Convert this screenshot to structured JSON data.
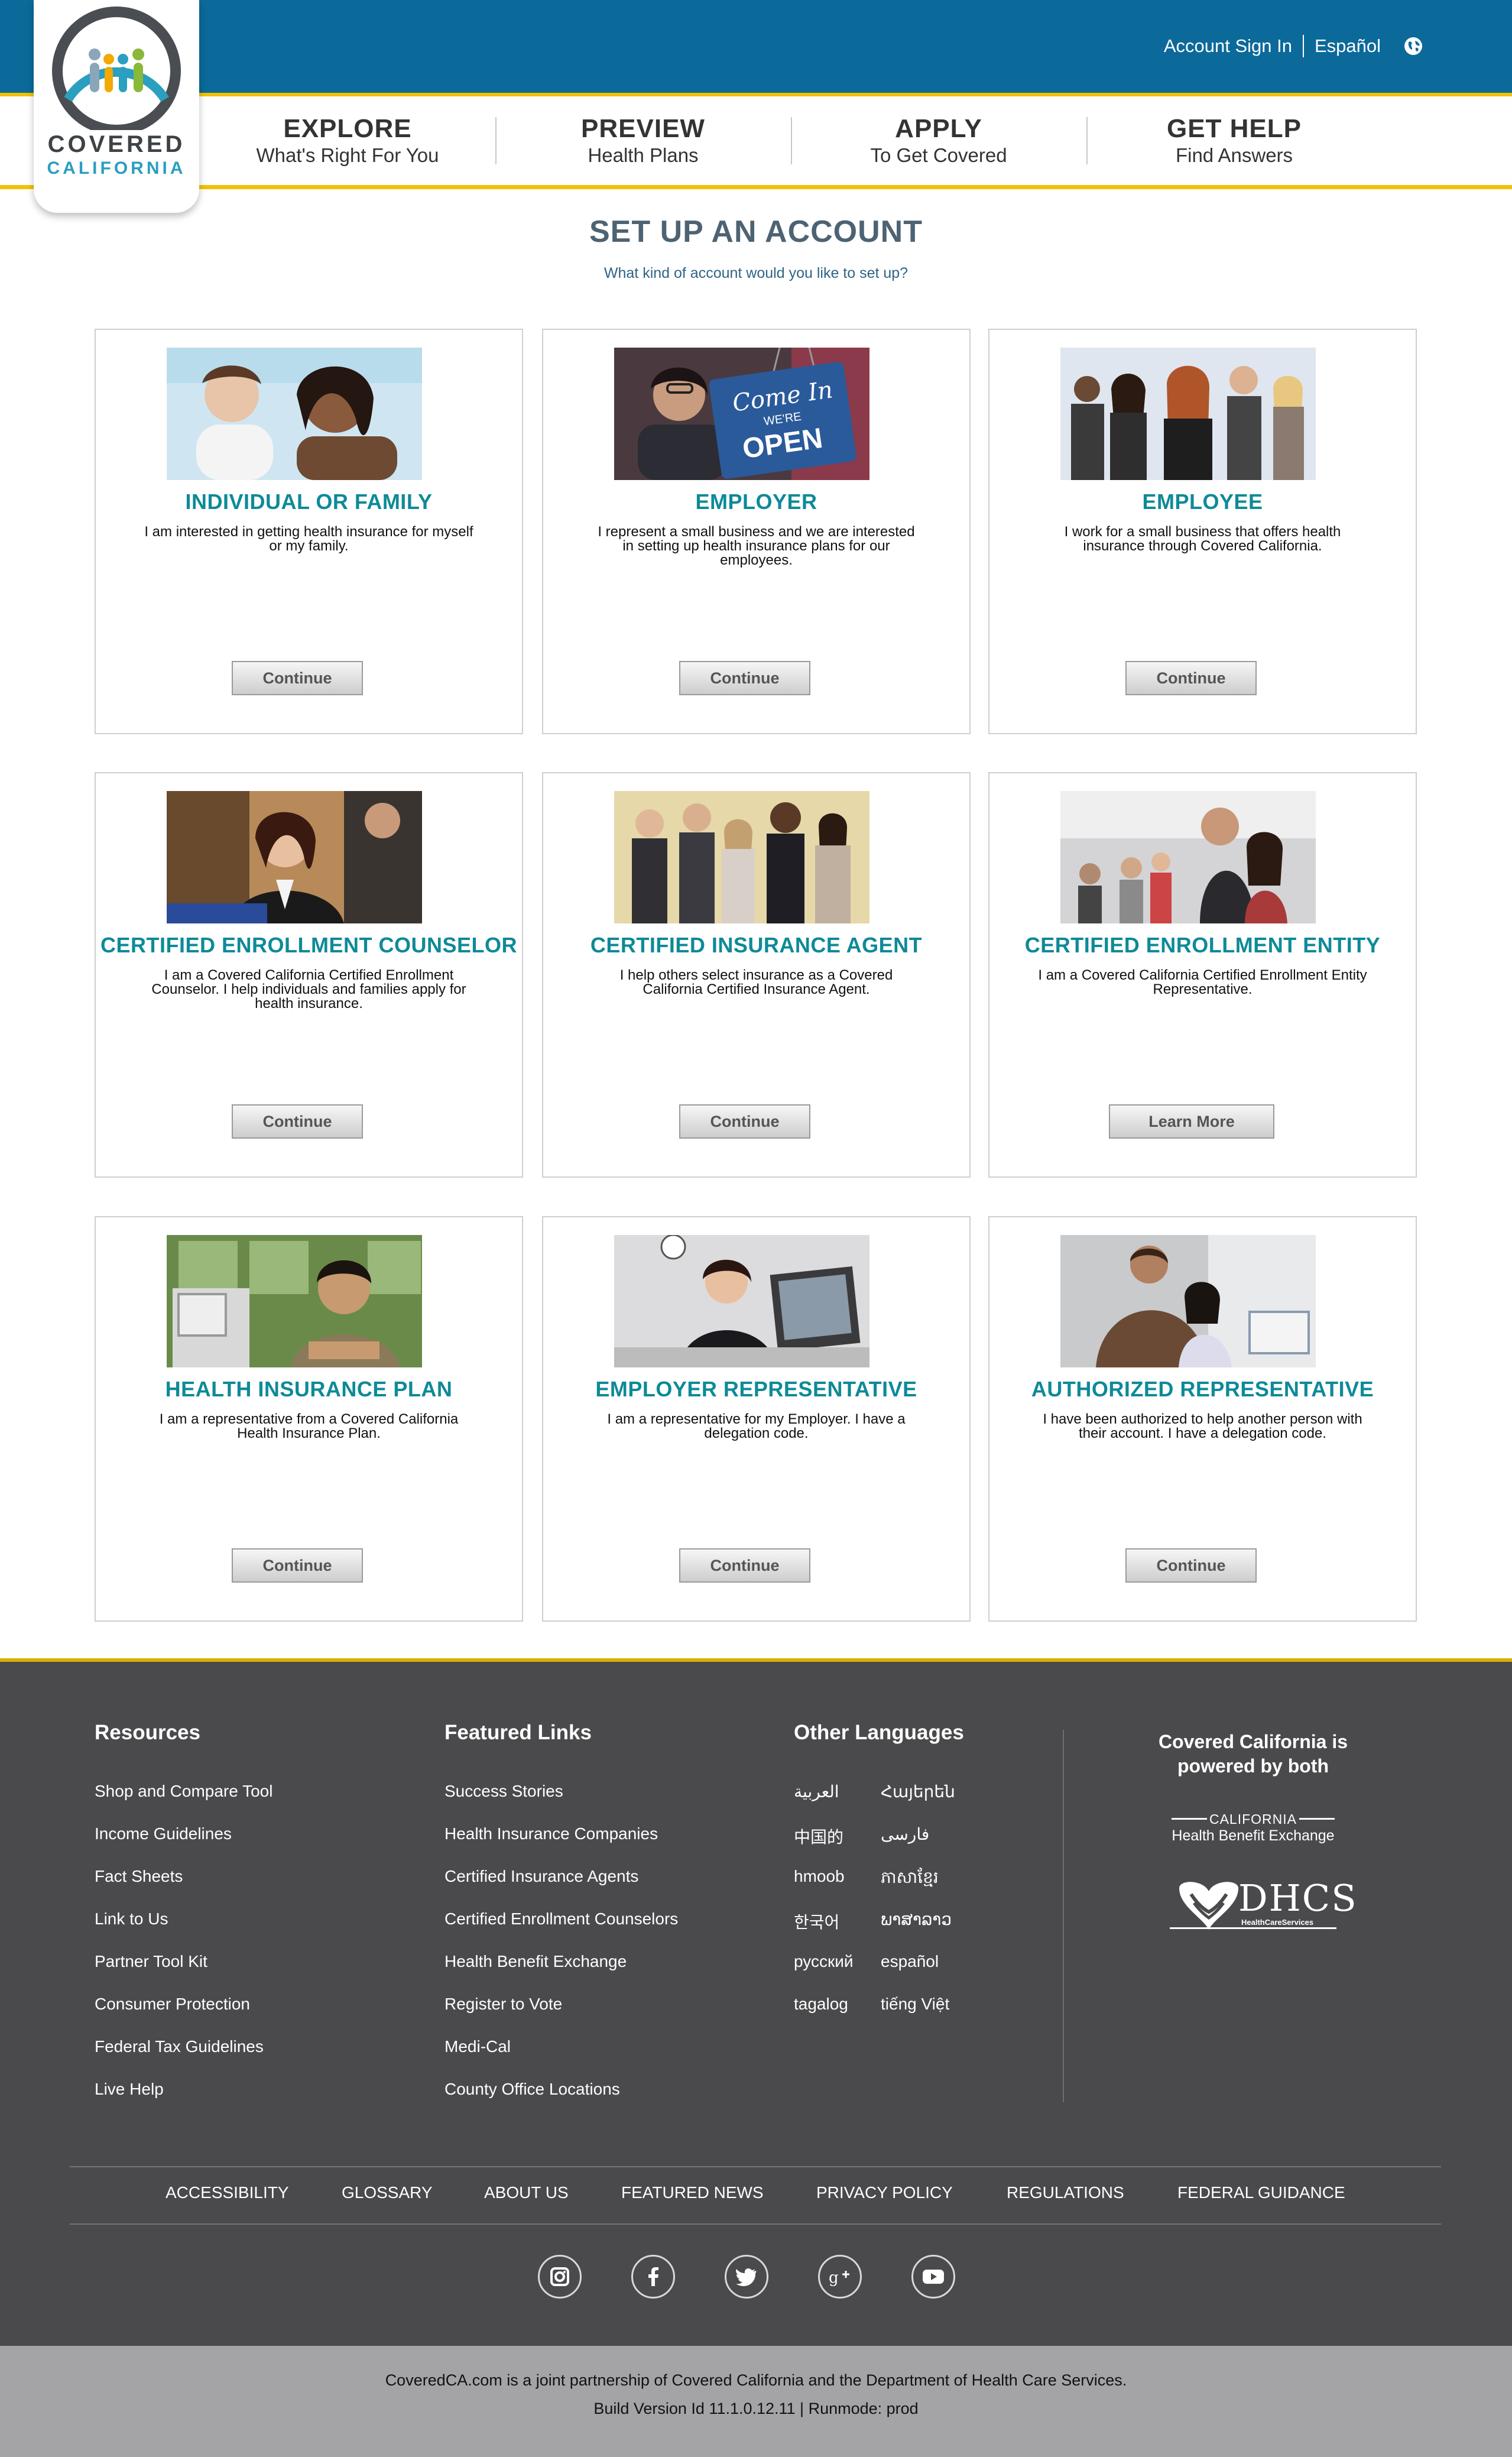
{
  "header": {
    "sign_in": "Account Sign In",
    "language": "Español",
    "logo_line1": "COVERED",
    "logo_line2": "CALIFORNIA"
  },
  "nav": [
    {
      "title": "EXPLORE",
      "sub": "What's Right For You"
    },
    {
      "title": "PREVIEW",
      "sub": "Health Plans"
    },
    {
      "title": "APPLY",
      "sub": "To Get Covered"
    },
    {
      "title": "GET HELP",
      "sub": "Find Answers"
    }
  ],
  "main": {
    "title": "SET UP AN ACCOUNT",
    "subtitle": "What kind of account would you like to set up?"
  },
  "cards": [
    {
      "title": "INDIVIDUAL OR FAMILY",
      "desc": "I am interested in getting health insurance for myself or my family.",
      "button": "Continue"
    },
    {
      "title": "EMPLOYER",
      "desc": "I represent a small business and we are interested in setting up health insurance plans for our employees.",
      "button": "Continue",
      "sign_text1": "Come In",
      "sign_text2": "WE'RE",
      "sign_text3": "OPEN"
    },
    {
      "title": "EMPLOYEE",
      "desc": "I work for a small business that offers health insurance through Covered California.",
      "button": "Continue"
    },
    {
      "title": "CERTIFIED ENROLLMENT COUNSELOR",
      "desc": "I am a Covered California Certified Enrollment Counselor. I help individuals and families apply for health insurance.",
      "button": "Continue"
    },
    {
      "title": "CERTIFIED INSURANCE AGENT",
      "desc": "I help others select insurance as a Covered California Certified Insurance Agent.",
      "button": "Continue"
    },
    {
      "title": "CERTIFIED ENROLLMENT ENTITY",
      "desc": "I am a Covered California Certified Enrollment Entity Representative.",
      "button": "Learn More"
    },
    {
      "title": "HEALTH INSURANCE PLAN",
      "desc": "I am a representative from a Covered California Health Insurance Plan.",
      "button": "Continue"
    },
    {
      "title": "EMPLOYER REPRESENTATIVE",
      "desc": "I am a representative for my Employer. I have a delegation code.",
      "button": "Continue"
    },
    {
      "title": "AUTHORIZED REPRESENTATIVE",
      "desc": "I have been authorized to help another person with their account. I have a delegation code.",
      "button": "Continue"
    }
  ],
  "footer": {
    "resources_title": "Resources",
    "resources": [
      "Shop and Compare Tool",
      "Income Guidelines",
      "Fact Sheets",
      "Link to Us",
      "Partner Tool Kit",
      "Consumer Protection",
      "Federal Tax Guidelines",
      "Live Help"
    ],
    "featured_title": "Featured Links",
    "featured": [
      "Success Stories",
      "Health Insurance Companies",
      "Certified Insurance Agents",
      "Certified Enrollment Counselors",
      "Health Benefit Exchange",
      "Register to Vote",
      "Medi-Cal",
      "County Office Locations"
    ],
    "languages_title": "Other Languages",
    "languages_left": [
      "العربية",
      "中国的",
      "hmoob",
      "한국어",
      "русский",
      "tagalog"
    ],
    "languages_right": [
      "Հայերեն",
      "فارسی",
      "ភាសាខ្មែរ",
      "ພາສາລາວ",
      "español",
      "tiếng Việt"
    ],
    "powered_by": "Covered California is powered by both",
    "chbe_line1": "CALIFORNIA",
    "chbe_line2": "Health Benefit Exchange",
    "dhcs_text": "DHCS",
    "dhcs_sub": "HealthCareServices",
    "bottom_links": [
      "ACCESSIBILITY",
      "GLOSSARY",
      "ABOUT US",
      "FEATURED NEWS",
      "PRIVACY POLICY",
      "REGULATIONS",
      "FEDERAL GUIDANCE"
    ],
    "social": [
      "instagram-icon",
      "facebook-icon",
      "twitter-icon",
      "google-plus-icon",
      "youtube-icon"
    ],
    "partnership": "CoveredCA.com is a joint partnership of Covered California and the Department of Health Care Services.",
    "build": "Build Version Id 11.1.0.12.11  |  Runmode: prod"
  },
  "colors": {
    "top_bar": "#0b6a9a",
    "gold": "#f2c200",
    "card_title": "#0e8a98",
    "footer_bg": "#4a4a4c",
    "bottom_bar": "#a4a3a6"
  }
}
